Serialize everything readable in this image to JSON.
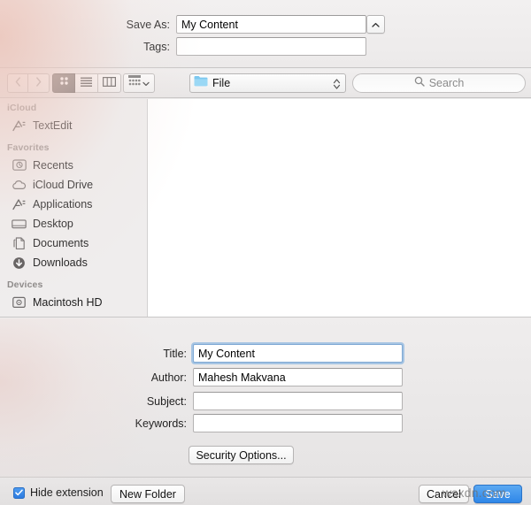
{
  "header": {
    "save_as_label": "Save As:",
    "save_as_value": "My Content",
    "tags_label": "Tags:",
    "tags_value": "",
    "tags_placeholder": "",
    "disclosure_icon": "chevron-up-icon"
  },
  "toolbar": {
    "back_icon": "chevron-left-icon",
    "forward_icon": "chevron-right-icon",
    "view_icon_grid": "icon-view-icon",
    "view_list": "list-view-icon",
    "view_column": "column-view-icon",
    "arrange_icon": "arrange-grid-icon",
    "arrange_chevron": "chevron-down-icon",
    "path_icon": "folder-icon",
    "path_label": "File",
    "path_stepper_icon": "up-down-stepper-icon",
    "search_icon": "search-icon",
    "search_placeholder": "Search"
  },
  "sidebar": {
    "sections": [
      {
        "title": "iCloud",
        "items": [
          {
            "label": "TextEdit",
            "icon": "textedit-app-icon"
          }
        ]
      },
      {
        "title": "Favorites",
        "items": [
          {
            "label": "Recents",
            "icon": "recents-clock-icon"
          },
          {
            "label": "iCloud Drive",
            "icon": "cloud-icon"
          },
          {
            "label": "Applications",
            "icon": "applications-icon"
          },
          {
            "label": "Desktop",
            "icon": "desktop-icon"
          },
          {
            "label": "Documents",
            "icon": "documents-icon"
          },
          {
            "label": "Downloads",
            "icon": "downloads-arrow-icon"
          }
        ]
      },
      {
        "title": "Devices",
        "items": [
          {
            "label": "Macintosh HD",
            "icon": "hard-drive-icon"
          }
        ]
      }
    ]
  },
  "accessory": {
    "title_label": "Title:",
    "title_value": "My Content",
    "author_label": "Author:",
    "author_value": "Mahesh Makvana",
    "subject_label": "Subject:",
    "subject_value": "",
    "keywords_label": "Keywords:",
    "keywords_value": "",
    "security_options_label": "Security Options..."
  },
  "footer": {
    "hide_extension_label": "Hide extension",
    "hide_extension_checked": true,
    "check_icon": "checkmark-icon",
    "new_folder_label": "New Folder",
    "cancel_label": "Cancel",
    "save_label": "Save"
  },
  "watermark": {
    "text": "wsxdn.com"
  },
  "colors": {
    "accent_blue": "#2f87e8",
    "focus_ring": "#7fa9d4",
    "folder_blue": "#7cc8ef",
    "panel_gray": "#efeded"
  }
}
